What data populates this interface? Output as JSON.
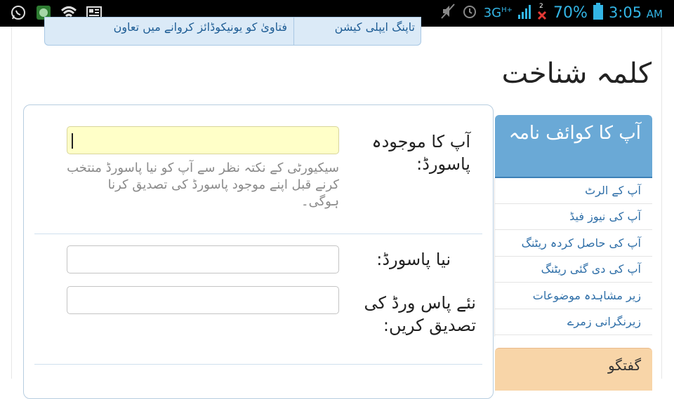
{
  "status_bar": {
    "network": "3G",
    "network_sup": "H+",
    "sim_badge": "2",
    "battery_percent": "70%",
    "time": "3:05",
    "ampm": "AM",
    "icons": [
      "whatsapp-icon",
      "app-icon",
      "wifi-icon",
      "news-icon",
      "mute-icon",
      "alarm-icon",
      "signal-icon",
      "no-signal-icon",
      "battery-icon"
    ]
  },
  "top_tabs": {
    "tab1": "تاپنگ ایپلی کیشن",
    "tab2": "فتاویٰ کو یونیکوڈائز کروانے میں تعاون"
  },
  "page_title": "کلمہ شناخت",
  "form": {
    "current_password_label": "آپ کا موجودہ پاسورڈ:",
    "current_password_value": "",
    "security_hint": "سیکیورٹی کے نکتہ نظر سے آپ کو نیا پاسورڈ منتخب کرنے قبل اپنے موجود پاسورڈ کی تصدیق کرنا ہوگی۔",
    "new_password_label": "نیا پاسورڈ:",
    "new_password_value": "",
    "confirm_password_label": "نئے پاس ورڈ کی تصدیق کریں:",
    "confirm_password_value": ""
  },
  "sidebar": {
    "heading": "آپ کا کوائف نامہ",
    "items": [
      {
        "label": "آپ کے الرٹ"
      },
      {
        "label": "آپ کی نیوز فیڈ"
      },
      {
        "label": "آپ کی حاصل کردہ ریٹنگ"
      },
      {
        "label": "آپ کی دی گئی ریٹنگ"
      },
      {
        "label": "زیر مشاہدہ موضوعات"
      },
      {
        "label": "زیرنگرانی زمرے"
      }
    ],
    "footer_heading": "گفتگو"
  },
  "colors": {
    "status_accent": "#33b5e5",
    "sidebar_header": "#6aa9d6",
    "link": "#2f6fa8",
    "active_input": "#ffffc8",
    "conversation_header": "#f8d5a8"
  }
}
